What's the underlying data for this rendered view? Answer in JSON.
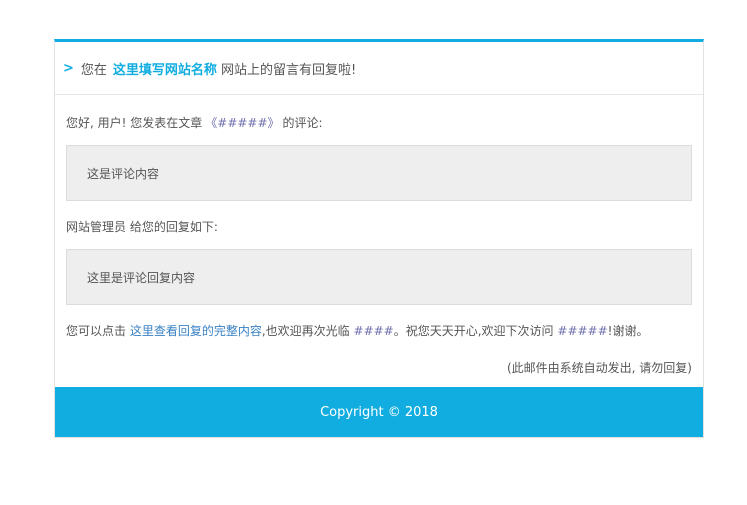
{
  "header": {
    "arrow": ">",
    "prefix": "您在",
    "site_name": "这里填写网站名称",
    "suffix": "网站上的留言有回复啦!"
  },
  "greeting": {
    "text": "您好, 用户! 您发表在文章",
    "article": "《#####》",
    "after": "的评论:"
  },
  "comment": "这是评论内容",
  "reply_intro": "网站管理员 给您的回复如下:",
  "reply": "这里是评论回复内容",
  "closing": {
    "part1": "您可以点击",
    "link": "这里查看回复的完整内容",
    "part2": ",也欢迎再次光临",
    "site1": "####",
    "part3": "。祝您天天开心,欢迎下次访问",
    "site2": "#####",
    "part4": "!谢谢。"
  },
  "auto_note": "(此邮件由系统自动发出, 请勿回复)",
  "footer": "Copyright © 2018",
  "colors": {
    "accent": "#12ade0",
    "link": "#3a82c4",
    "box_bg": "#eeeeee"
  }
}
